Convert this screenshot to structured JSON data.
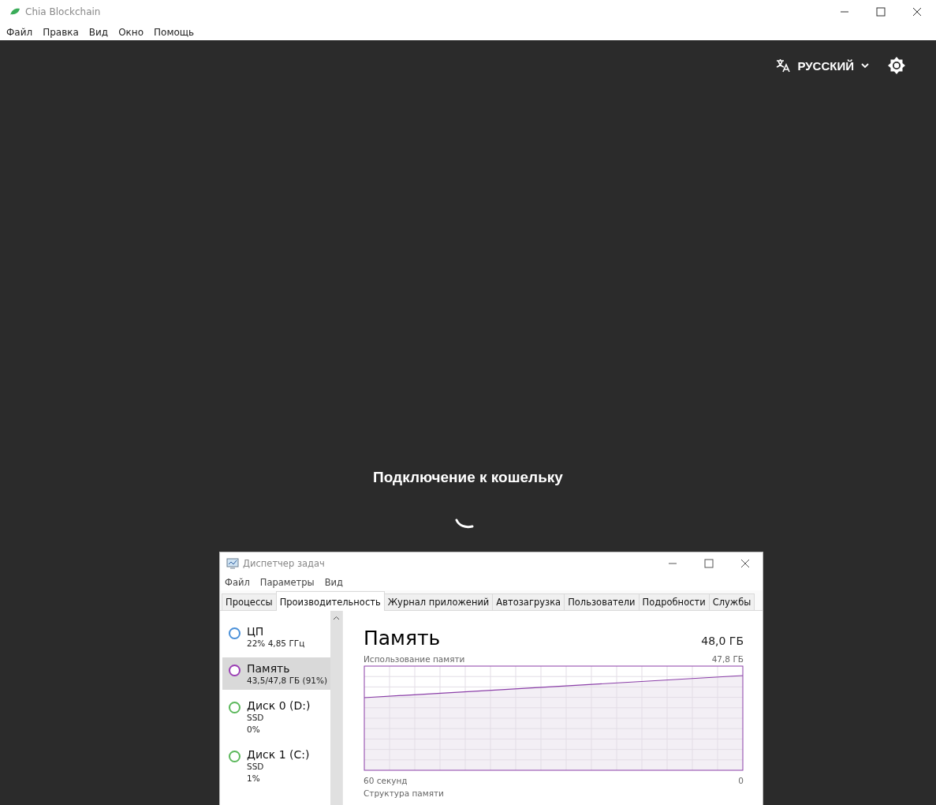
{
  "window": {
    "title": "Chia Blockchain"
  },
  "menu": [
    "Файл",
    "Правка",
    "Вид",
    "Окно",
    "Помощь"
  ],
  "toolbar": {
    "language": "РУССКИЙ"
  },
  "status": {
    "message": "Подключение к кошельку"
  },
  "task_manager": {
    "title": "Диспетчер задач",
    "menu": [
      "Файл",
      "Параметры",
      "Вид"
    ],
    "tabs": [
      {
        "label": "Процессы",
        "selected": false
      },
      {
        "label": "Производительность",
        "selected": true
      },
      {
        "label": "Журнал приложений",
        "selected": false
      },
      {
        "label": "Автозагрузка",
        "selected": false
      },
      {
        "label": "Пользователи",
        "selected": false
      },
      {
        "label": "Подробности",
        "selected": false
      },
      {
        "label": "Службы",
        "selected": false
      }
    ],
    "resources": [
      {
        "name": "ЦП",
        "details": [
          "22% 4,85 ГГц"
        ],
        "color": "#4a90d9",
        "selected": false
      },
      {
        "name": "Память",
        "details": [
          "43,5/47,8 ГБ (91%)"
        ],
        "color": "#9b3fb5",
        "selected": true
      },
      {
        "name": "Диск 0 (D:)",
        "details": [
          "SSD",
          "0%"
        ],
        "color": "#5cb85c",
        "selected": false
      },
      {
        "name": "Диск 1 (C:)",
        "details": [
          "SSD",
          "1%"
        ],
        "color": "#5cb85c",
        "selected": false
      }
    ],
    "panel": {
      "title": "Память",
      "total": "48,0 ГБ",
      "graph_label": "Использование памяти",
      "graph_max": "47,8 ГБ",
      "time_start": "60 секунд",
      "time_end": "0",
      "section": "Структура памяти"
    }
  }
}
